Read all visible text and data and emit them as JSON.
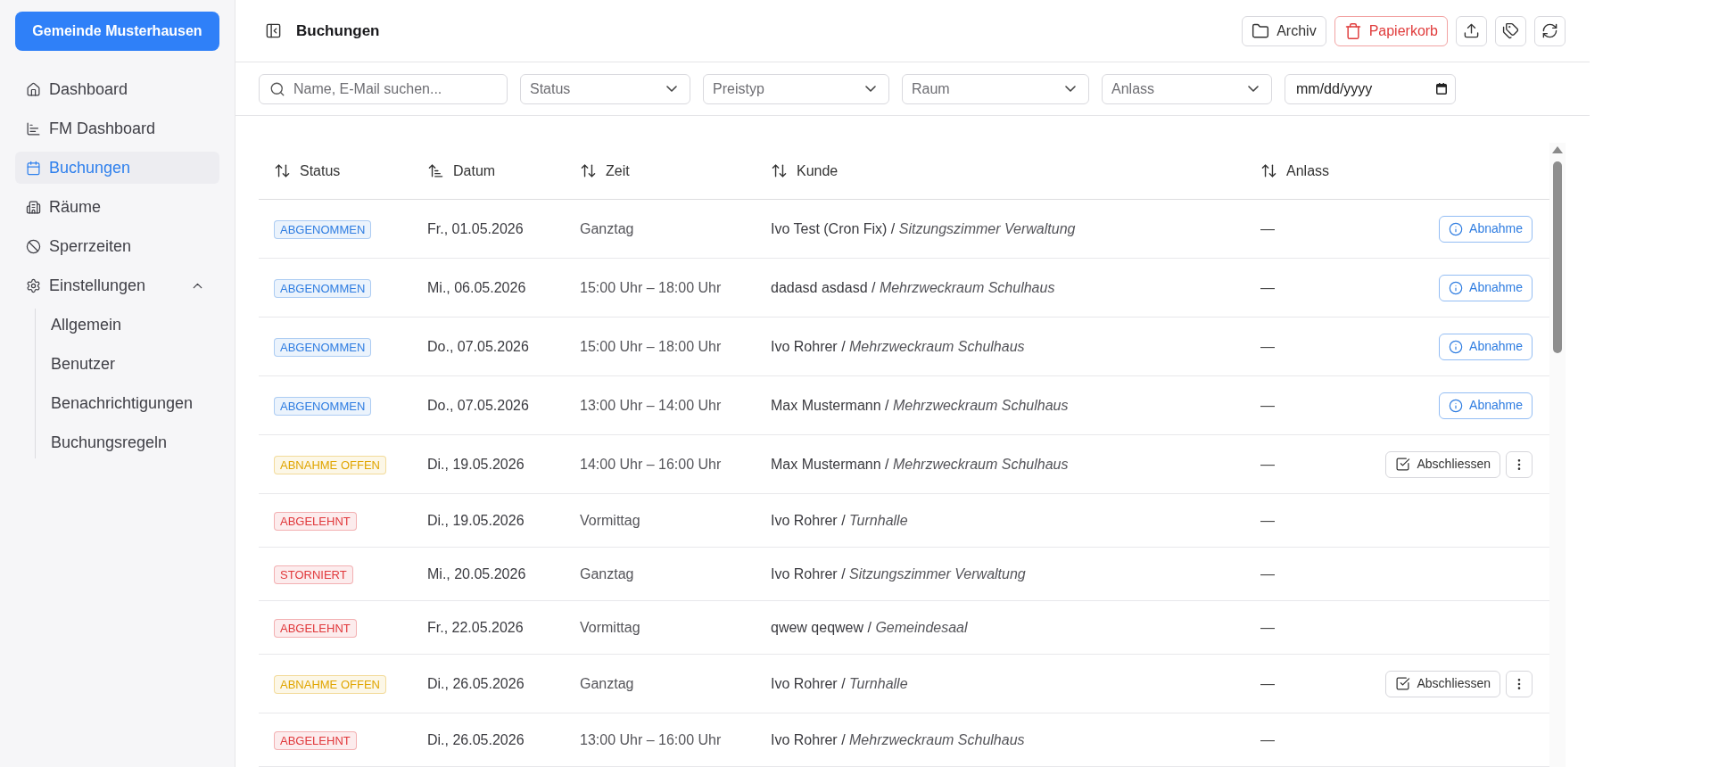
{
  "sidebar": {
    "brand": "Gemeinde Musterhausen",
    "items": [
      {
        "label": "Dashboard",
        "selected": false
      },
      {
        "label": "FM Dashboard",
        "selected": false
      },
      {
        "label": "Buchungen",
        "selected": true
      },
      {
        "label": "Räume",
        "selected": false
      },
      {
        "label": "Sperrzeiten",
        "selected": false
      },
      {
        "label": "Einstellungen",
        "selected": false,
        "expanded": true,
        "children": [
          {
            "label": "Allgemein",
            "selected": false
          },
          {
            "label": "Benutzer",
            "selected": false
          },
          {
            "label": "Benachrichtigungen",
            "selected": false
          },
          {
            "label": "Buchungsregeln",
            "selected": false
          }
        ]
      }
    ]
  },
  "header": {
    "title": "Buchungen",
    "actions": [
      {
        "kind": "neutral",
        "label": "Archiv"
      },
      {
        "kind": "danger",
        "label": "Papierkorb"
      }
    ]
  },
  "filters": {
    "search": {
      "placeholder": "Name, E-Mail suchen..."
    },
    "selects": [
      {
        "placeholder": "Status"
      },
      {
        "placeholder": "Preistyp"
      },
      {
        "placeholder": "Raum"
      },
      {
        "placeholder": "Anlass"
      }
    ],
    "date": {
      "placeholder": "mm/dd/yyyy"
    }
  },
  "table": {
    "columns": [
      {
        "label": "Status",
        "sorted": false
      },
      {
        "label": "Datum",
        "sorted": true
      },
      {
        "label": "Zeit",
        "sorted": false
      },
      {
        "label": "Kunde",
        "sorted": false
      },
      {
        "label": "Anlass",
        "sorted": false
      }
    ],
    "rows": [
      {
        "status": {
          "label": "ABGENOMMEN",
          "color": "#2f7de1"
        },
        "date": "Fr., 01.05.2026",
        "time": "Ganztag",
        "customer": "Ivo Test (Cron Fix) / *Sitzungszimmer Verwaltung*",
        "occasion": "—",
        "actions": [
          {
            "kind": "accept",
            "label": "Abnahme"
          }
        ]
      },
      {
        "status": {
          "label": "ABGENOMMEN",
          "color": "#2f7de1"
        },
        "date": "Mi., 06.05.2026",
        "time": "15:00 Uhr – 18:00 Uhr",
        "customer": "dadasd asdasd / *Mehrzweckraum Schulhaus*",
        "occasion": "—",
        "actions": [
          {
            "kind": "accept",
            "label": "Abnahme"
          }
        ]
      },
      {
        "status": {
          "label": "ABGENOMMEN",
          "color": "#2f7de1"
        },
        "date": "Do., 07.05.2026",
        "time": "15:00 Uhr – 18:00 Uhr",
        "customer": "Ivo Rohrer / *Mehrzweckraum Schulhaus*",
        "occasion": "—",
        "actions": [
          {
            "kind": "accept",
            "label": "Abnahme"
          }
        ]
      },
      {
        "status": {
          "label": "ABGENOMMEN",
          "color": "#2f7de1"
        },
        "date": "Do., 07.05.2026",
        "time": "13:00 Uhr – 14:00 Uhr",
        "customer": "Max Mustermann / *Mehrzweckraum Schulhaus*",
        "occasion": "—",
        "actions": [
          {
            "kind": "accept",
            "label": "Abnahme"
          }
        ]
      },
      {
        "status": {
          "label": "ABNAHME OFFEN",
          "color": "#e0a500"
        },
        "date": "Di., 19.05.2026",
        "time": "14:00 Uhr – 16:00 Uhr",
        "customer": "Max Mustermann / *Mehrzweckraum Schulhaus*",
        "occasion": "—",
        "actions": [
          {
            "kind": "complete",
            "label": "Abschliessen"
          },
          {
            "kind": "more"
          }
        ]
      },
      {
        "status": {
          "label": "ABGELEHNT",
          "color": "#e0383b"
        },
        "date": "Di., 19.05.2026",
        "time": "Vormittag",
        "customer": "Ivo Rohrer / *Turnhalle*",
        "occasion": "—"
      },
      {
        "status": {
          "label": "STORNIERT",
          "color": "#e0383b"
        },
        "date": "Mi., 20.05.2026",
        "time": "Ganztag",
        "customer": "Ivo Rohrer / *Sitzungszimmer Verwaltung*",
        "occasion": "—"
      },
      {
        "status": {
          "label": "ABGELEHNT",
          "color": "#e0383b"
        },
        "date": "Fr., 22.05.2026",
        "time": "Vormittag",
        "customer": "qwew qeqwew / *Gemeindesaal*",
        "occasion": "—"
      },
      {
        "status": {
          "label": "ABNAHME OFFEN",
          "color": "#e0a500"
        },
        "date": "Di., 26.05.2026",
        "time": "Ganztag",
        "customer": "Ivo Rohrer / *Turnhalle*",
        "occasion": "—",
        "actions": [
          {
            "kind": "complete",
            "label": "Abschliessen"
          },
          {
            "kind": "more"
          }
        ]
      },
      {
        "status": {
          "label": "ABGELEHNT",
          "color": "#e0383b"
        },
        "date": "Di., 26.05.2026",
        "time": "13:00 Uhr – 16:00 Uhr",
        "customer": "Ivo Rohrer / *Mehrzweckraum Schulhaus*",
        "occasion": "—"
      }
    ]
  }
}
